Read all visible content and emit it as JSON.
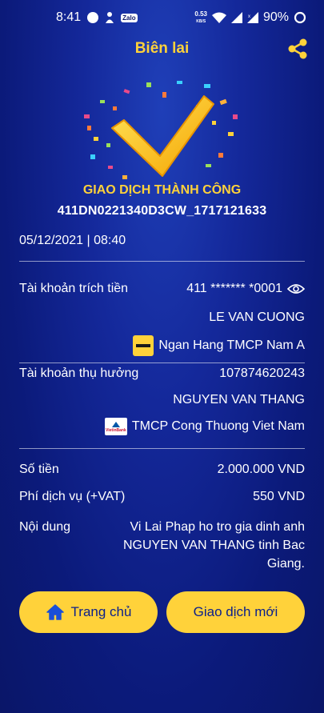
{
  "status": {
    "time": "8:41",
    "zalo": "Zalo",
    "speed_value": "0.53",
    "speed_unit": "KB/S",
    "battery": "90%"
  },
  "header": {
    "title": "Biên lai"
  },
  "result": {
    "title": "GIAO DỊCH THÀNH CÔNG",
    "txn_id": "411DN0221340D3CW_1717121633"
  },
  "datetime": "05/12/2021 | 08:40",
  "source": {
    "label": "Tài khoản trích tiền",
    "account": "411 ******* *0001",
    "name": "LE VAN CUONG",
    "bank": "Ngan Hang TMCP Nam A"
  },
  "beneficiary": {
    "label": "Tài khoản thụ hưởng",
    "account": "107874620243",
    "name": "NGUYEN VAN THANG",
    "bank": "TMCP Cong Thuong Viet Nam",
    "bank_logo_text": "VietinBank"
  },
  "amount": {
    "label": "Số tiền",
    "value": "2.000.000 VND"
  },
  "fee": {
    "label": "Phí dịch vụ (+VAT)",
    "value": "550 VND"
  },
  "content": {
    "label": "Nội dung",
    "line1": "Vi Lai Phap ho tro gia dinh anh",
    "line2": "NGUYEN VAN THANG tinh Bac",
    "line3": "Giang."
  },
  "buttons": {
    "home": "Trang chủ",
    "new": "Giao dịch mới"
  },
  "colors": {
    "accent": "#ffd23a",
    "background": "#0b1a7a",
    "button_text": "#0a1f8c"
  }
}
